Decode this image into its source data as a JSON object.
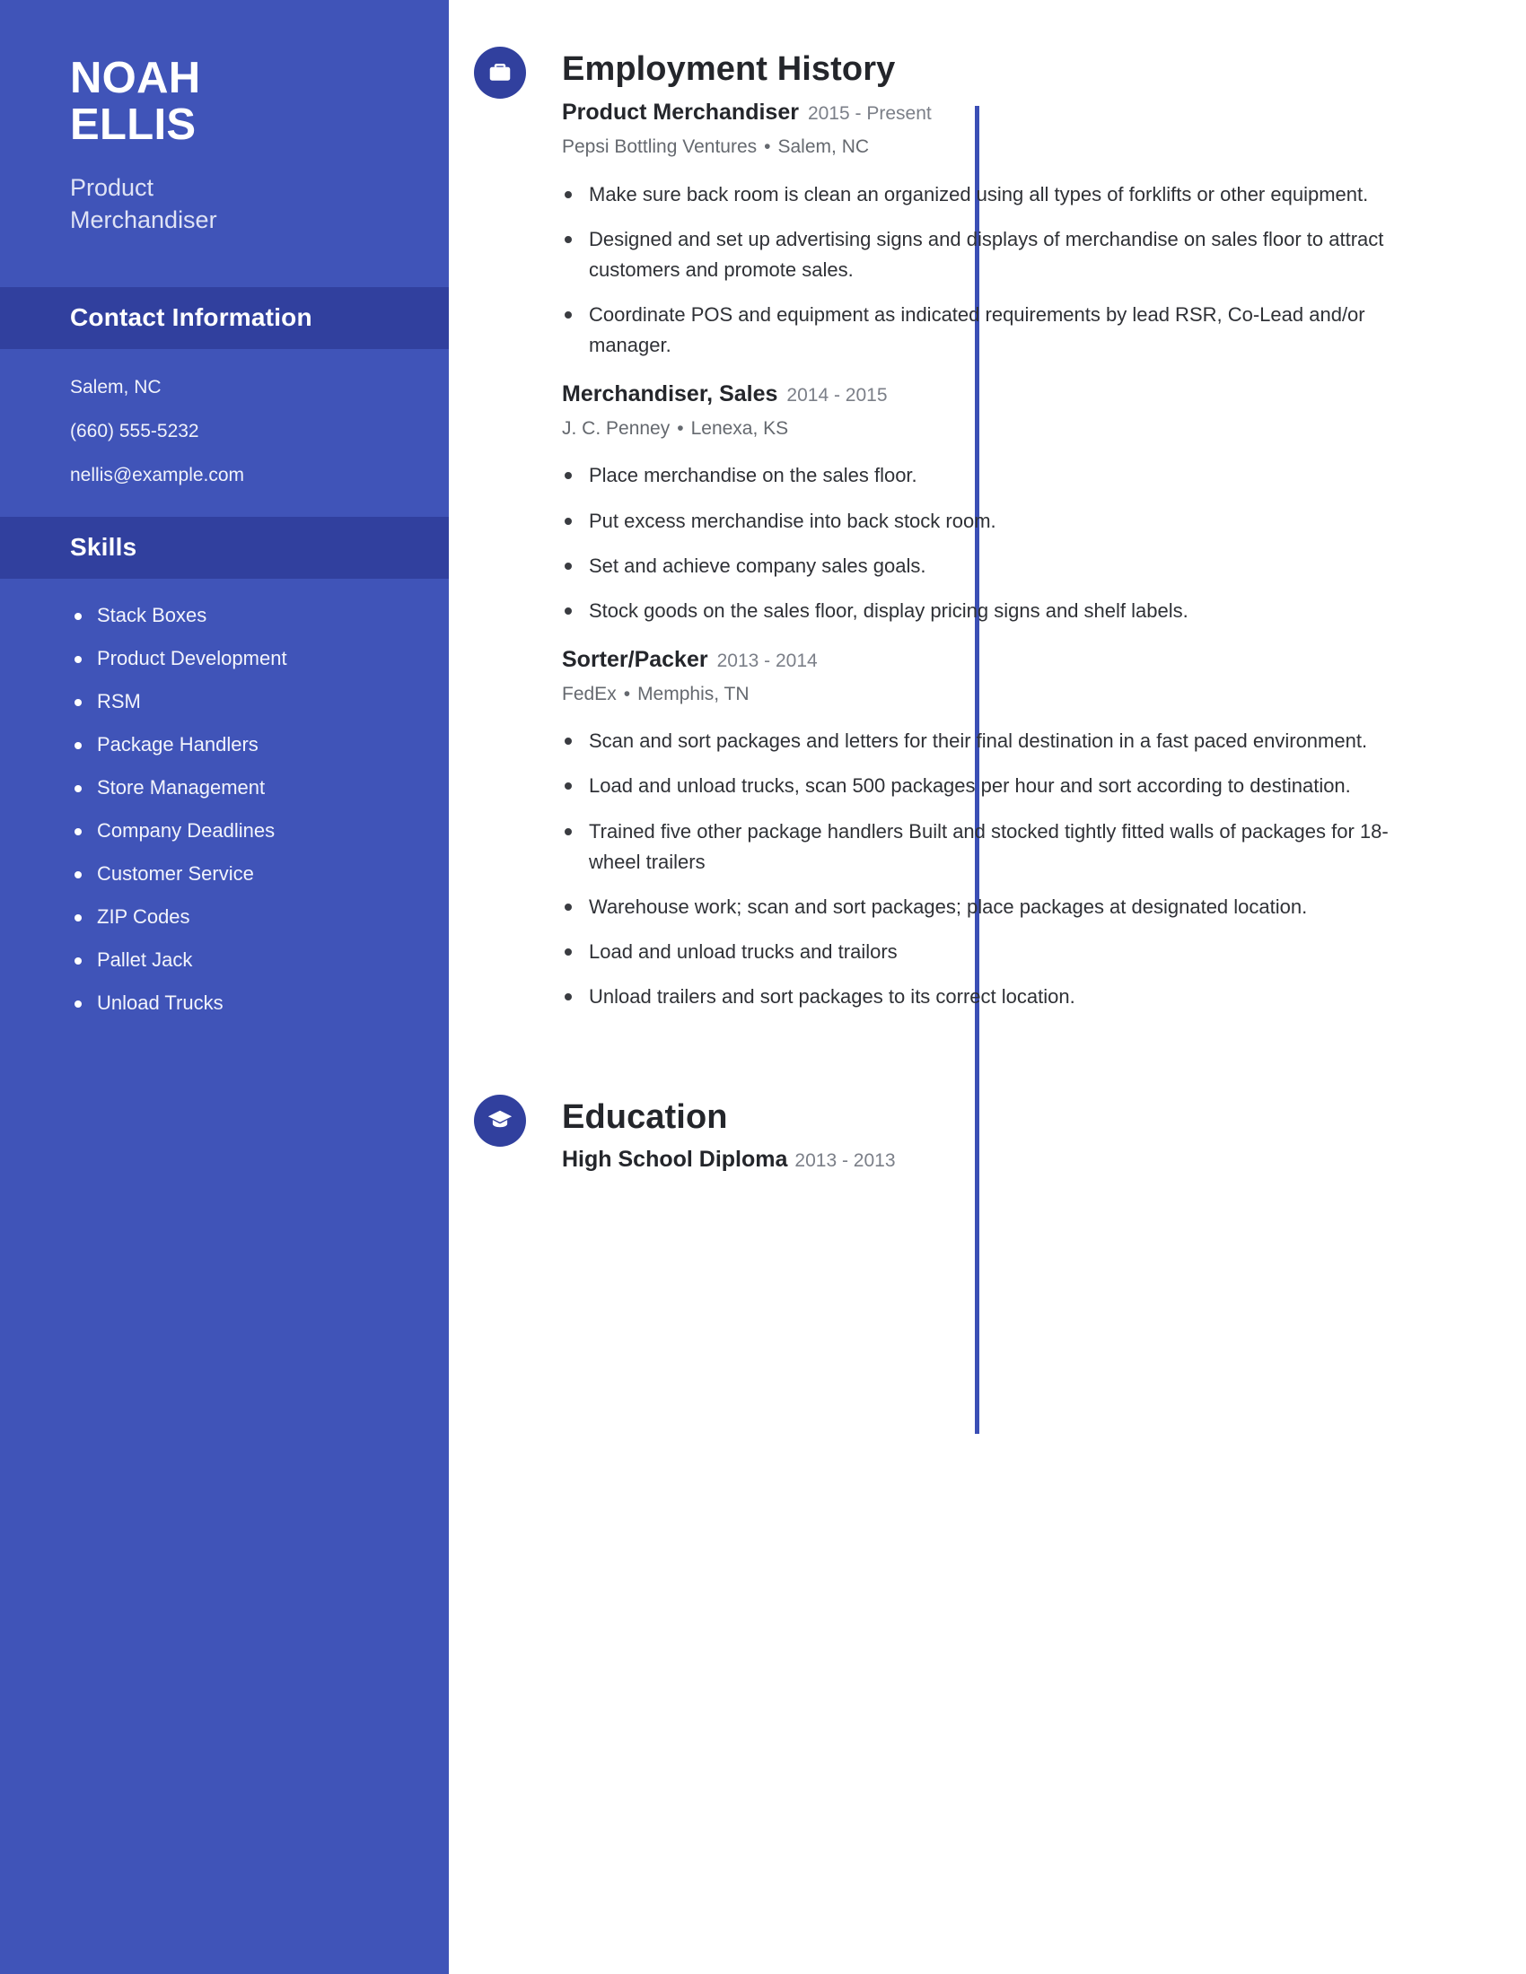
{
  "theme": {
    "sidebar_bg": "#4054b8",
    "band_bg": "#31409e",
    "accent": "#3b4fb5",
    "text_dark": "#24262b",
    "text_muted": "#7b7f88"
  },
  "sidebar": {
    "name_first": "NOAH",
    "name_last": "ELLIS",
    "role_line1": "Product",
    "role_line2": "Merchandiser",
    "contact": {
      "heading": "Contact Information",
      "location": "Salem, NC",
      "phone": "(660) 555-5232",
      "email": "nellis@example.com"
    },
    "skills": {
      "heading": "Skills",
      "items": [
        "Stack Boxes",
        "Product Development",
        "RSM",
        "Package Handlers",
        "Store Management",
        "Company Deadlines",
        "Customer Service",
        "ZIP Codes",
        "Pallet Jack",
        "Unload Trucks"
      ]
    }
  },
  "main": {
    "employment": {
      "heading": "Employment History",
      "icon": "briefcase-icon",
      "jobs": [
        {
          "title": "Product Merchandiser",
          "dates": "2015 - Present",
          "company": "Pepsi Bottling Ventures",
          "separator": "•",
          "location": "Salem, NC",
          "bullets": [
            "Make sure back room is clean an organized using all types of forklifts or other equipment.",
            "Designed and set up advertising signs and displays of merchandise on sales floor to attract customers and promote sales.",
            "Coordinate POS and equipment as indicated requirements by lead RSR, Co-Lead and/or manager."
          ]
        },
        {
          "title": "Merchandiser, Sales",
          "dates": "2014 - 2015",
          "company": "J. C. Penney",
          "separator": "•",
          "location": "Lenexa, KS",
          "bullets": [
            "Place merchandise on the sales floor.",
            "Put excess merchandise into back stock room.",
            "Set and achieve company sales goals.",
            "Stock goods on the sales floor, display pricing signs and shelf labels."
          ]
        },
        {
          "title": "Sorter/Packer",
          "dates": "2013 - 2014",
          "company": "FedEx",
          "separator": "•",
          "location": "Memphis, TN",
          "bullets": [
            "Scan and sort packages and letters for their final destination in a fast paced environment.",
            "Load and unload trucks, scan 500 packages per hour and sort according to destination.",
            "Trained five other package handlers Built and stocked tightly fitted walls of packages for 18-wheel trailers",
            "Warehouse work; scan and sort packages; place packages at designated location.",
            "Load and unload trucks and trailors",
            "Unload trailers and sort packages to its correct location."
          ]
        }
      ]
    },
    "education": {
      "heading": "Education",
      "icon": "graduation-cap-icon",
      "entries": [
        {
          "degree": "High School Diploma",
          "dates": "2013 - 2013"
        }
      ]
    }
  }
}
